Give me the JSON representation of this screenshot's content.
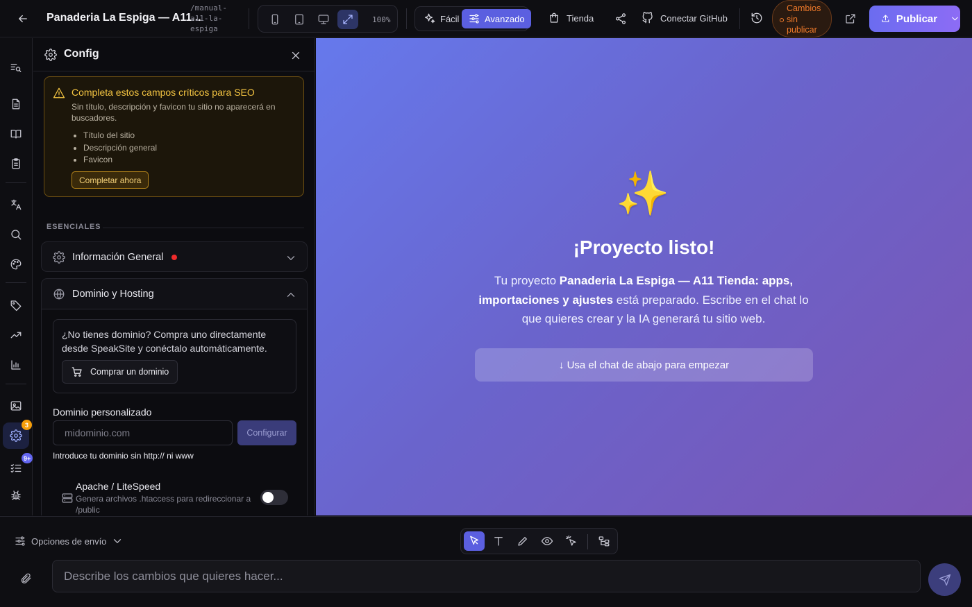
{
  "header": {
    "project_title": "Panaderia La Espiga — A11...",
    "project_slug": "/manual-a11-la-espiga",
    "zoom": "100%",
    "mode_easy": "Fácil",
    "mode_advanced": "Avanzado",
    "store": "Tienda",
    "connect_github": "Conectar GitHub",
    "unsaved": "Cambios sin publicar",
    "publish": "Publicar"
  },
  "rail": {
    "settings_badge": "3",
    "tasks_badge": "9+"
  },
  "panel": {
    "title": "Config",
    "warning": {
      "title": "Completa estos campos críticos para SEO",
      "description": "Sin título, descripción y favicon tu sitio no aparecerá en buscadores.",
      "items": [
        "Título del sitio",
        "Descripción general",
        "Favicon"
      ],
      "button": "Completar ahora"
    },
    "section_label": "ESENCIALES",
    "general_info": "Información General",
    "domain_hosting": "Dominio y Hosting",
    "buy_domain_text": "¿No tienes dominio? Compra uno directamente desde SpeakSite y conéctalo automáticamente.",
    "buy_domain_button": "Comprar un dominio",
    "custom_domain_label": "Dominio personalizado",
    "custom_domain_placeholder": "midominio.com",
    "configure_button": "Configurar",
    "domain_help": "Introduce tu dominio sin http:// ni www",
    "apache_title": "Apache / LiteSpeed",
    "apache_desc": "Genera archivos .htaccess para redireccionar a /public"
  },
  "preview": {
    "icon": "✨",
    "title": "¡Proyecto listo!",
    "text_pre": "Tu proyecto",
    "text_bold": "Panaderia La Espiga — A11 Tienda: apps, importaciones y ajustes",
    "text_post": "está preparado. Escribe en el chat lo que quieres crear y la IA generará tu sitio web.",
    "cta": "↓ Usa el chat de abajo para empezar"
  },
  "chat": {
    "send_options": "Opciones de envío",
    "placeholder": "Describe los cambios que quieres hacer..."
  },
  "colors": {
    "accent": "#5b5fe0",
    "warning": "#f5c542",
    "unsaved": "#f07a2a",
    "danger": "#ef2b2b"
  }
}
